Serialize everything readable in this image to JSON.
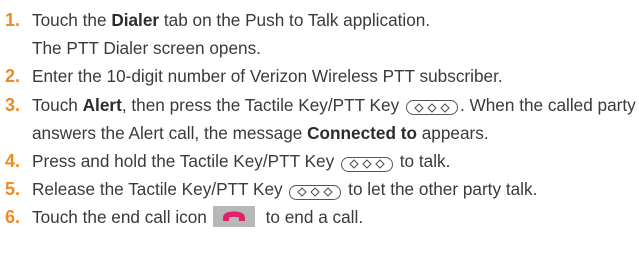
{
  "steps": [
    {
      "num": "1.",
      "a": "Touch the ",
      "bold": "Dialer",
      "b": " tab on the Push to Talk application.",
      "line2": "The PTT Dialer screen opens."
    },
    {
      "num": "2.",
      "text": "Enter the 10-digit number of Verizon Wireless PTT subscriber."
    },
    {
      "num": "3.",
      "a": "Touch ",
      "bold": "Alert",
      "b": ", then press the Tactile Key/PTT Key",
      "c": ". When the called party answers the Alert call, the message ",
      "bold2": "Connected to",
      "d": "appears."
    },
    {
      "num": "4.",
      "a": "Press and hold the Tactile Key/PTT Key",
      "b": " to talk."
    },
    {
      "num": "5.",
      "a": "Release the Tactile Key/PTT Key",
      "b": " to let the other party talk."
    },
    {
      "num": "6.",
      "a": "Touch the end call icon",
      "b": " to end a call."
    }
  ],
  "icons": {
    "ptt_key": "ptt-key-icon",
    "end_call": "end-call-icon",
    "end_call_color": "#e0226a",
    "end_call_bg": "#b8b8b8",
    "step_number_color": "#f08a1c"
  }
}
